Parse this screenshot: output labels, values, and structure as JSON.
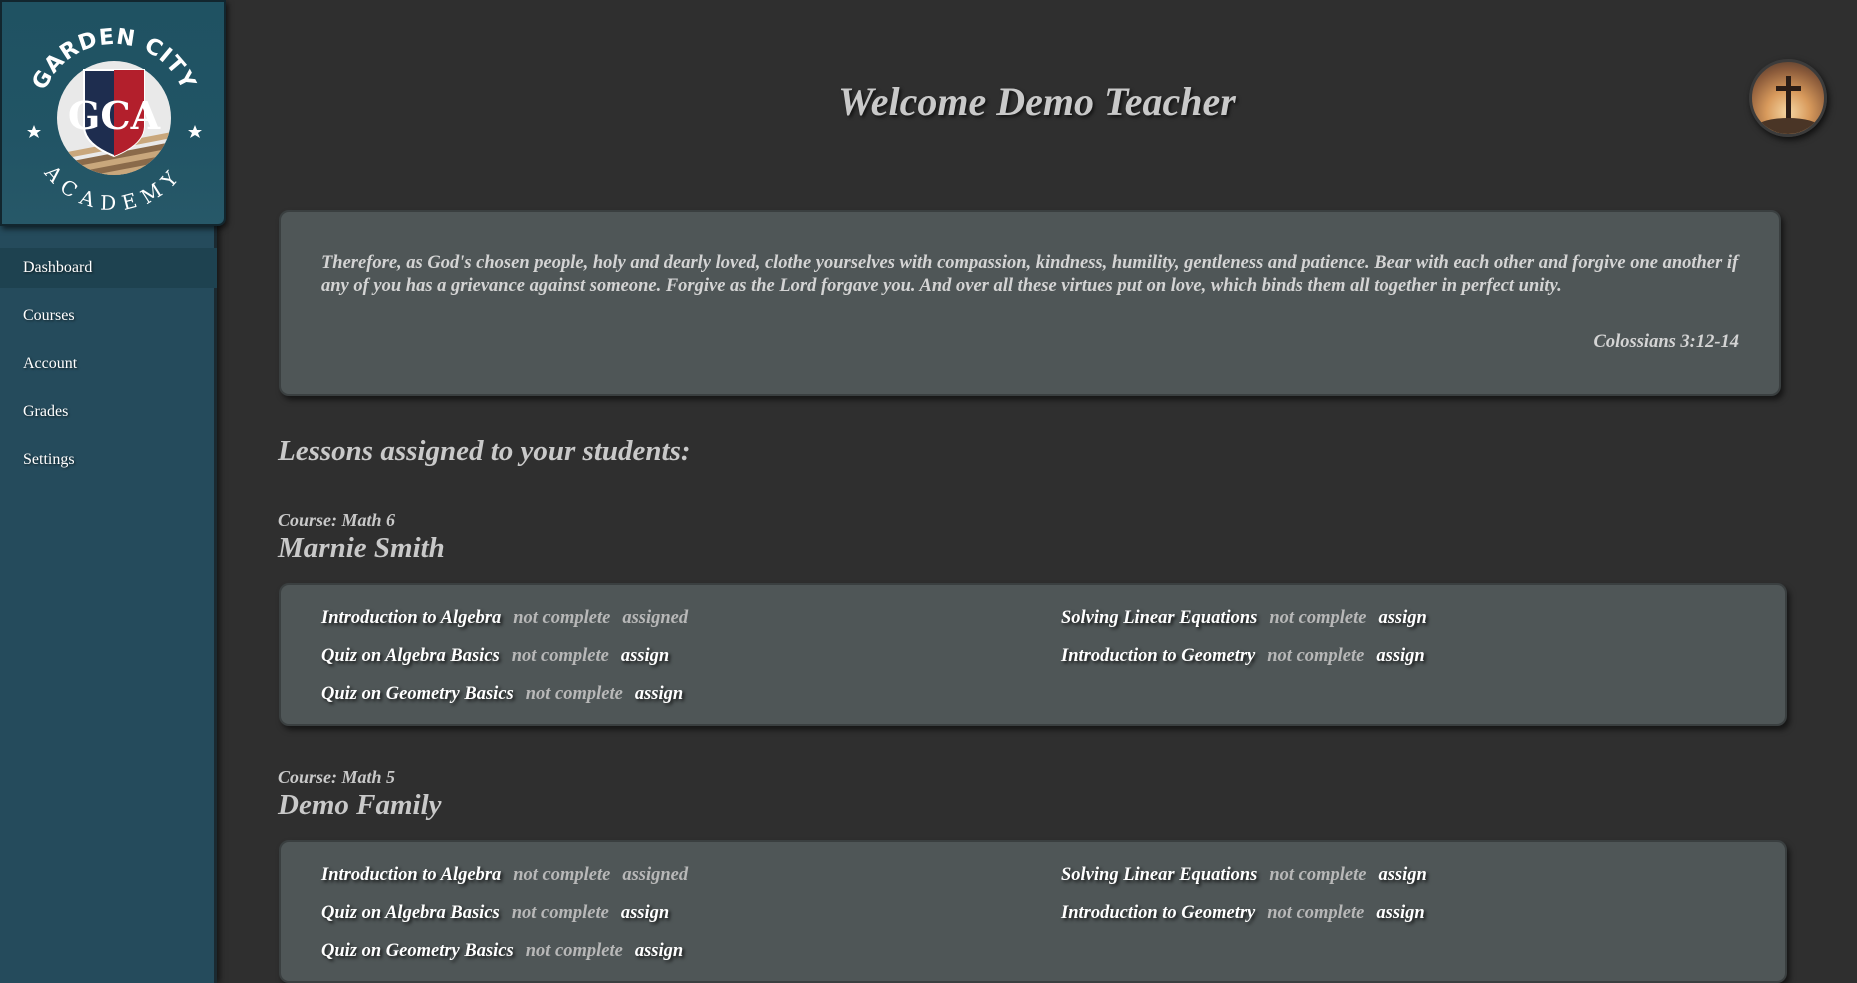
{
  "logo": {
    "arc_top": "GARDEN CITY",
    "arc_bottom": "ACADEMY",
    "monogram": "GCA"
  },
  "sidebar": {
    "items": [
      {
        "label": "Dashboard",
        "active": true
      },
      {
        "label": "Courses"
      },
      {
        "label": "Account"
      },
      {
        "label": "Grades"
      },
      {
        "label": "Settings"
      }
    ]
  },
  "header": {
    "title": "Welcome Demo Teacher",
    "avatar_icon": "cross-icon"
  },
  "verse": {
    "text": "Therefore, as God's chosen people, holy and dearly loved, clothe yourselves with compassion, kindness, humility, gentleness and patience. Bear with each other and forgive one another if any of you has a grievance against someone. Forgive as the Lord forgave you. And over all these virtues put on love, which binds them all together in perfect unity.",
    "reference": "Colossians 3:12-14"
  },
  "lessons_heading": "Lessons assigned to your students:",
  "students": [
    {
      "course": "Course: Math 6",
      "name": "Marnie Smith",
      "lessons": [
        {
          "title": "Introduction to Algebra",
          "status": "not complete",
          "action": "assigned"
        },
        {
          "title": "Solving Linear Equations",
          "status": "not complete",
          "action": "assign"
        },
        {
          "title": "Quiz on Algebra Basics",
          "status": "not complete",
          "action": "assign"
        },
        {
          "title": "Introduction to Geometry",
          "status": "not complete",
          "action": "assign"
        },
        {
          "title": "Quiz on Geometry Basics",
          "status": "not complete",
          "action": "assign"
        }
      ]
    },
    {
      "course": "Course: Math 5",
      "name": "Demo Family",
      "lessons": [
        {
          "title": "Introduction to Algebra",
          "status": "not complete",
          "action": "assigned"
        },
        {
          "title": "Solving Linear Equations",
          "status": "not complete",
          "action": "assign"
        },
        {
          "title": "Quiz on Algebra Basics",
          "status": "not complete",
          "action": "assign"
        },
        {
          "title": "Introduction to Geometry",
          "status": "not complete",
          "action": "assign"
        },
        {
          "title": "Quiz on Geometry Basics",
          "status": "not complete",
          "action": "assign"
        }
      ]
    }
  ]
}
